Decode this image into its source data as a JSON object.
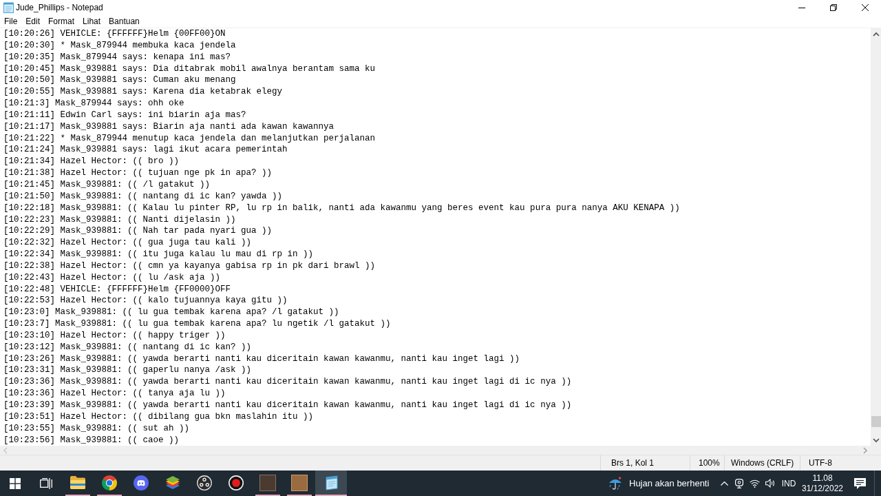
{
  "window": {
    "title": "Jude_Phillips - Notepad"
  },
  "menu": [
    "File",
    "Edit",
    "Format",
    "Lihat",
    "Bantuan"
  ],
  "editor": {
    "lines": [
      "[10:20:26] VEHICLE: {FFFFFF}Helm {00FF00}ON",
      "[10:20:30] * Mask_879944 membuka kaca jendela",
      "[10:20:35] Mask_879944 says: kenapa ini mas?",
      "[10:20:45] Mask_939881 says: Dia ditabrak mobil awalnya berantam sama ku",
      "[10:20:50] Mask_939881 says: Cuman aku menang",
      "[10:20:55] Mask_939881 says: Karena dia ketabrak elegy",
      "[10:21:3] Mask_879944 says: ohh oke",
      "[10:21:11] Edwin Carl says: ini biarin aja mas?",
      "[10:21:17] Mask_939881 says: Biarin aja nanti ada kawan kawannya",
      "[10:21:22] * Mask_879944 menutup kaca jendela dan melanjutkan perjalanan",
      "[10:21:24] Mask_939881 says: lagi ikut acara pemerintah",
      "[10:21:34] Hazel Hector: (( bro ))",
      "[10:21:38] Hazel Hector: (( tujuan nge pk in apa? ))",
      "[10:21:45] Mask_939881: (( /l gatakut ))",
      "[10:21:50] Mask_939881: (( nantang di ic kan? yawda ))",
      "[10:22:18] Mask_939881: (( Kalau lu pinter RP, lu rp in balik, nanti ada kawanmu yang beres event kau pura pura nanya AKU KENAPA ))",
      "[10:22:23] Mask_939881: (( Nanti dijelasin ))",
      "[10:22:29] Mask_939881: (( Nah tar pada nyari gua ))",
      "[10:22:32] Hazel Hector: (( gua juga tau kali ))",
      "[10:22:34] Mask_939881: (( itu juga kalau lu mau di rp in ))",
      "[10:22:38] Hazel Hector: (( cmn ya kayanya gabisa rp in pk dari brawl ))",
      "[10:22:43] Hazel Hector: (( lu /ask aja ))",
      "[10:22:48] VEHICLE: {FFFFFF}Helm {FF0000}OFF",
      "[10:22:53] Hazel Hector: (( kalo tujuannya kaya gitu ))",
      "[10:23:0] Mask_939881: (( lu gua tembak karena apa? /l gatakut ))",
      "[10:23:7] Mask_939881: (( lu gua tembak karena apa? lu ngetik /l gatakut ))",
      "[10:23:10] Hazel Hector: (( happy triger ))",
      "[10:23:12] Mask_939881: (( nantang di ic kan? ))",
      "[10:23:26] Mask_939881: (( yawda berarti nanti kau diceritain kawan kawanmu, nanti kau inget lagi ))",
      "[10:23:31] Mask_939881: (( gaperlu nanya /ask ))",
      "[10:23:36] Mask_939881: (( yawda berarti nanti kau diceritain kawan kawanmu, nanti kau inget lagi di ic nya ))",
      "[10:23:36] Hazel Hector: (( tanya aja lu ))",
      "[10:23:39] Mask_939881: (( yawda berarti nanti kau diceritain kawan kawanmu, nanti kau inget lagi di ic nya ))",
      "[10:23:51] Hazel Hector: (( dibilang gua bkn maslahin itu ))",
      "[10:23:55] Mask_939881: (( sut ah ))",
      "[10:23:56] Mask_939881: (( caoe ))"
    ]
  },
  "status_bar": {
    "position": "Brs 1, Kol 1",
    "zoom": "100%",
    "line_ending": "Windows (CRLF)",
    "encoding": "UTF-8"
  },
  "taskbar": {
    "buttons": [
      {
        "kind": "start"
      },
      {
        "kind": "taskview"
      }
    ],
    "apps": [
      {
        "kind": "folder",
        "running": true,
        "selected": false
      },
      {
        "kind": "chrome",
        "running": true,
        "selected": false
      },
      {
        "kind": "discord",
        "running": false,
        "selected": false
      },
      {
        "kind": "bluestacks",
        "running": false,
        "selected": false
      },
      {
        "kind": "obs",
        "running": false,
        "selected": false
      },
      {
        "kind": "recorder",
        "running": false,
        "selected": false
      },
      {
        "kind": "photo",
        "running": true,
        "selected": false
      },
      {
        "kind": "photo",
        "running": true,
        "selected": false
      },
      {
        "kind": "notepad",
        "running": true,
        "selected": true
      }
    ],
    "weather": "Hujan akan berhenti",
    "language": "IND",
    "time": "11.08",
    "date": "31/12/2022"
  }
}
